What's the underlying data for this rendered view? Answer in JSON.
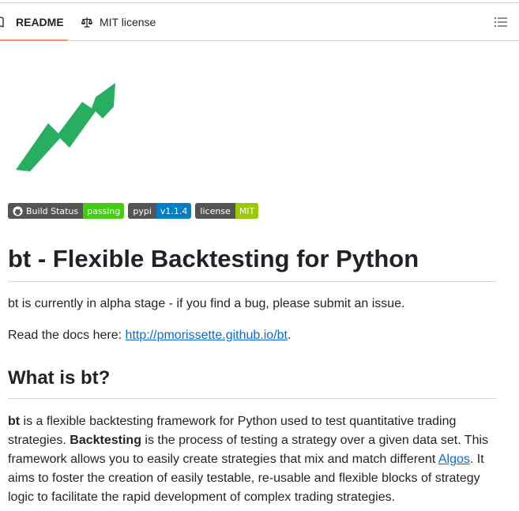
{
  "tabs": {
    "readme": {
      "label": "README",
      "icon": "book-icon",
      "active": true
    },
    "license": {
      "label": "MIT license",
      "icon": "law-scale-icon"
    },
    "outline_icon": "list-unordered-icon",
    "active_underline_color": "#fd8c73"
  },
  "logo": {
    "icon": "trend-arrow-icon",
    "color": "#27ae60"
  },
  "badges": [
    {
      "left": "Build Status",
      "right": "passing",
      "right_color": "#44cc11",
      "icon": "github-icon"
    },
    {
      "left": "pypi",
      "right": "v1.1.4",
      "right_color": "#007ec6"
    },
    {
      "left": "license",
      "right": "MIT",
      "right_color": "#97ca00"
    }
  ],
  "readme": {
    "title": "bt - Flexible Backtesting for Python",
    "alpha_notice": "bt is currently in alpha stage - if you find a bug, please submit an issue.",
    "docs_prefix": "Read the docs here: ",
    "docs_link": "http://pmorissette.github.io/bt",
    "docs_suffix": ".",
    "what_heading": "What is bt?",
    "desc": {
      "bt_bold": "bt",
      "part1": " is a flexible backtesting framework for Python used to test quantitative trading strategies. ",
      "backtesting_bold": "Backtesting",
      "part2": " is the process of testing a strategy over a given data set. This framework allows you to easily create strategies that mix and match different ",
      "algos_link": "Algos",
      "part3": ". It aims to foster the creation of easily testable, re-usable and flexible blocks of strategy logic to facilitate the rapid development of complex trading strategies."
    }
  },
  "colors": {
    "link": "#0969da",
    "text": "#1f2328",
    "border": "#d1d9e0"
  }
}
